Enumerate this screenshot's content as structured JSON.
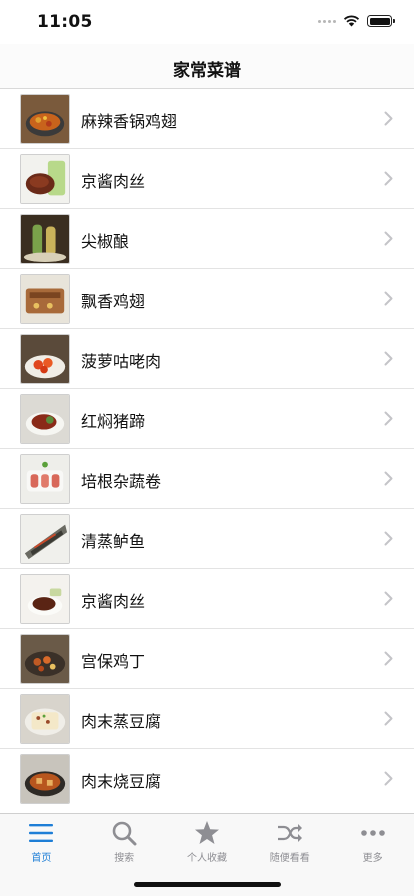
{
  "status_bar": {
    "time": "11:05"
  },
  "nav": {
    "title": "家常菜谱"
  },
  "recipes": [
    {
      "name": "麻辣香锅鸡翅"
    },
    {
      "name": "京酱肉丝"
    },
    {
      "name": "尖椒酿"
    },
    {
      "name": "飘香鸡翅"
    },
    {
      "name": "菠萝咕咾肉"
    },
    {
      "name": "红焖猪蹄"
    },
    {
      "name": "培根杂蔬卷"
    },
    {
      "name": "清蒸鲈鱼"
    },
    {
      "name": "京酱肉丝"
    },
    {
      "name": "宫保鸡丁"
    },
    {
      "name": "肉末蒸豆腐"
    },
    {
      "name": "肉末烧豆腐"
    }
  ],
  "tabs": [
    {
      "label": "首页",
      "icon": "list-icon",
      "active": true
    },
    {
      "label": "搜索",
      "icon": "search-icon",
      "active": false
    },
    {
      "label": "个人收藏",
      "icon": "star-icon",
      "active": false
    },
    {
      "label": "随便看看",
      "icon": "shuffle-icon",
      "active": false
    },
    {
      "label": "更多",
      "icon": "more-icon",
      "active": false
    }
  ],
  "colors": {
    "active_tab": "#1e7ed6",
    "inactive_tab": "#8e8e93"
  }
}
